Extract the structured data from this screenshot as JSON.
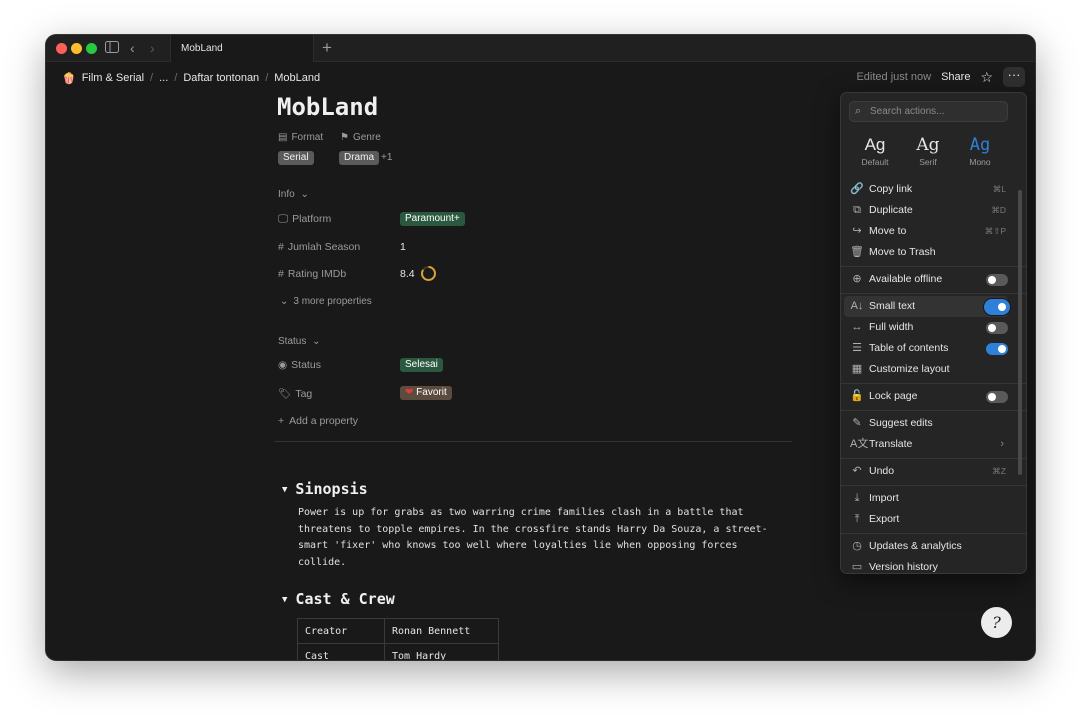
{
  "tab": {
    "title": "MobLand",
    "new_tab": "+"
  },
  "breadcrumb": {
    "items": [
      "Film & Serial",
      "...",
      "Daftar tontonan",
      "MobLand"
    ],
    "separator": "/"
  },
  "header": {
    "edited": "Edited just now",
    "share": "Share",
    "more": "···"
  },
  "page": {
    "title": "MobLand",
    "format_label": "Format",
    "genre_label": "Genre",
    "format_value": "Serial",
    "genre_value": "Drama",
    "genre_more": "+1",
    "info_section": "Info",
    "properties": [
      {
        "label": "Platform",
        "value": "Paramount+"
      },
      {
        "label": "Jumlah Season",
        "value": "1"
      },
      {
        "label": "Rating IMDb",
        "value": "8.4"
      }
    ],
    "more_properties": "3 more properties",
    "status_section": "Status",
    "status_label": "Status",
    "status_value": "Selesai",
    "tag_label": "Tag",
    "tag_value": "Favorit",
    "add_property": "Add a property",
    "rating_progress": 0.84
  },
  "synopsis": {
    "heading": "Sinopsis",
    "text": "Power is up for grabs as two warring crime families clash in a battle that threatens to topple empires. In the crossfire stands Harry Da Souza, a street-smart 'fixer' who knows too well where loyalties lie when opposing forces collide."
  },
  "cast": {
    "heading": "Cast & Crew",
    "rows": [
      {
        "role": "Creator",
        "name": "Ronan Bennett"
      },
      {
        "role": "Cast",
        "name": "Tom Hardy"
      }
    ]
  },
  "menu": {
    "search_placeholder": "Search actions...",
    "fonts": [
      {
        "glyph": "Ag",
        "label": "Default"
      },
      {
        "glyph": "Ag",
        "label": "Serif"
      },
      {
        "glyph": "Ag",
        "label": "Mono"
      }
    ],
    "items": {
      "copy_link": {
        "label": "Copy link",
        "shortcut": "⌘L"
      },
      "duplicate": {
        "label": "Duplicate",
        "shortcut": "⌘D"
      },
      "move_to": {
        "label": "Move to",
        "shortcut": "⌘⇧P"
      },
      "move_to_trash": {
        "label": "Move to Trash"
      },
      "available_offline": {
        "label": "Available offline",
        "on": false
      },
      "small_text": {
        "label": "Small text",
        "on": true
      },
      "full_width": {
        "label": "Full width",
        "on": false
      },
      "table_of_contents": {
        "label": "Table of contents",
        "on": true
      },
      "customize_layout": {
        "label": "Customize layout"
      },
      "lock_page": {
        "label": "Lock page",
        "on": false
      },
      "suggest_edits": {
        "label": "Suggest edits"
      },
      "translate": {
        "label": "Translate"
      },
      "undo": {
        "label": "Undo",
        "shortcut": "⌘Z"
      },
      "import": {
        "label": "Import"
      },
      "export": {
        "label": "Export"
      },
      "updates_analytics": {
        "label": "Updates & analytics"
      },
      "version_history": {
        "label": "Version history"
      }
    }
  },
  "colors": {
    "accent_blue": "#2f80d9",
    "tag_green": "#2b593f",
    "rating_ring": "#d9a13a"
  }
}
